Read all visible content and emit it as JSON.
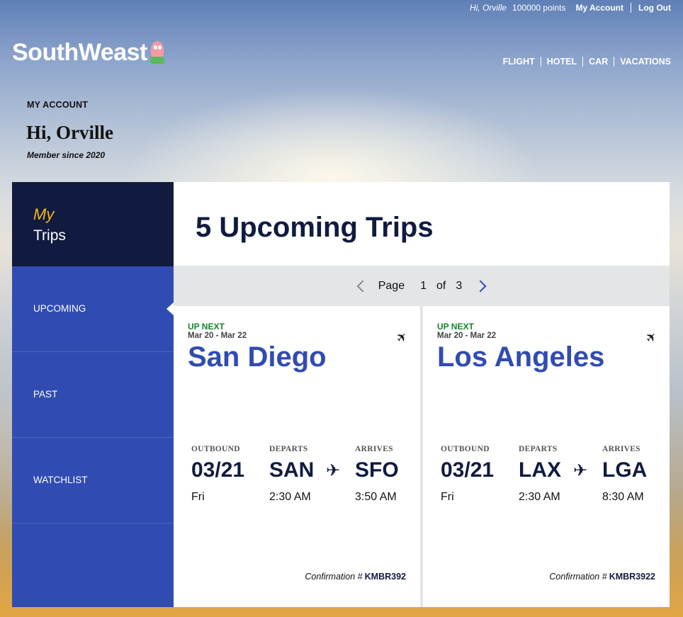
{
  "topbar": {
    "greeting": "Hi, Orville",
    "points": "100000 points",
    "my_account": "My Account",
    "logout": "Log Out"
  },
  "logo": {
    "text": "SouthWeast"
  },
  "nav": {
    "items": [
      "FLIGHT",
      "HOTEL",
      "CAR",
      "VACATIONS"
    ]
  },
  "account": {
    "label": "MY ACCOUNT",
    "name": "Hi, Orville",
    "member_since": "Member since 2020"
  },
  "sidebar": {
    "my": "My",
    "trips": "Trips",
    "items": [
      {
        "label": "UPCOMING",
        "active": true
      },
      {
        "label": "PAST",
        "active": false
      },
      {
        "label": "WATCHLIST",
        "active": false
      }
    ]
  },
  "main": {
    "title": "5 Upcoming Trips",
    "pager": {
      "label": "Page",
      "current": "1",
      "of": "of",
      "total": "3"
    }
  },
  "labels": {
    "outbound": "OUTBOUND",
    "departs": "DEPARTS",
    "arrives": "ARRIVES",
    "confirmation": "Confirmation #"
  },
  "trips": [
    {
      "tag": "UP NEXT",
      "start": "Mar 20",
      "end": "Mar 22",
      "city": "San Diego",
      "date": "03/21",
      "day": "Fri",
      "from": "SAN",
      "depart_time": "2:30 AM",
      "to": "SFO",
      "arrive_time": "3:50 AM",
      "confirmation": "KMBR392"
    },
    {
      "tag": "UP NEXT",
      "start": "Mar 20",
      "end": "Mar 22",
      "city": "Los Angeles",
      "date": "03/21",
      "day": "Fri",
      "from": "LAX",
      "depart_time": "2:30 AM",
      "to": "LGA",
      "arrive_time": "8:30 AM",
      "confirmation": "KMBR3922"
    }
  ],
  "colors": {
    "brand_blue": "#304cb2",
    "navy": "#111b40",
    "accent_yellow": "#f9b612",
    "up_next_green": "#13862a"
  }
}
